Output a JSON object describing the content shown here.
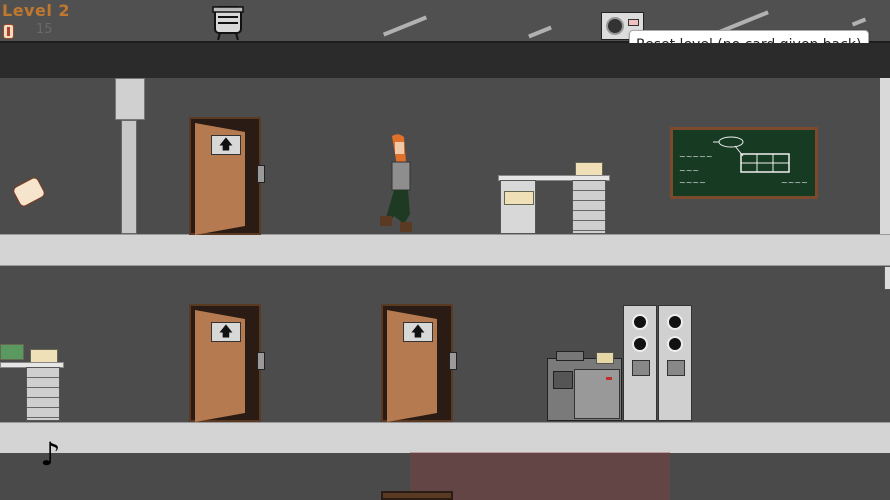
{
  "hud": {
    "level_label": "Level 2",
    "card_count": "15",
    "reset_tooltip": "Reset level (no card given back)"
  },
  "icons": {
    "card": "keycard-icon",
    "reset": "fan-reset-icon",
    "music": "music-note-icon",
    "door_sign": "up-arrow-icon"
  },
  "doors": [
    {
      "sign": "🡅"
    },
    {
      "sign": "🡅"
    },
    {
      "sign": "🡅"
    }
  ],
  "chalkboard": {
    "notes": [
      "~~~~~",
      "~~~",
      "~~~~",
      "~~~~"
    ]
  },
  "music_note": "♪",
  "colors": {
    "level_text": "#c07830",
    "board": "#173a23",
    "wall": "#4c4c4c",
    "floor": "#d4d4d4",
    "door": "#b57a50"
  }
}
